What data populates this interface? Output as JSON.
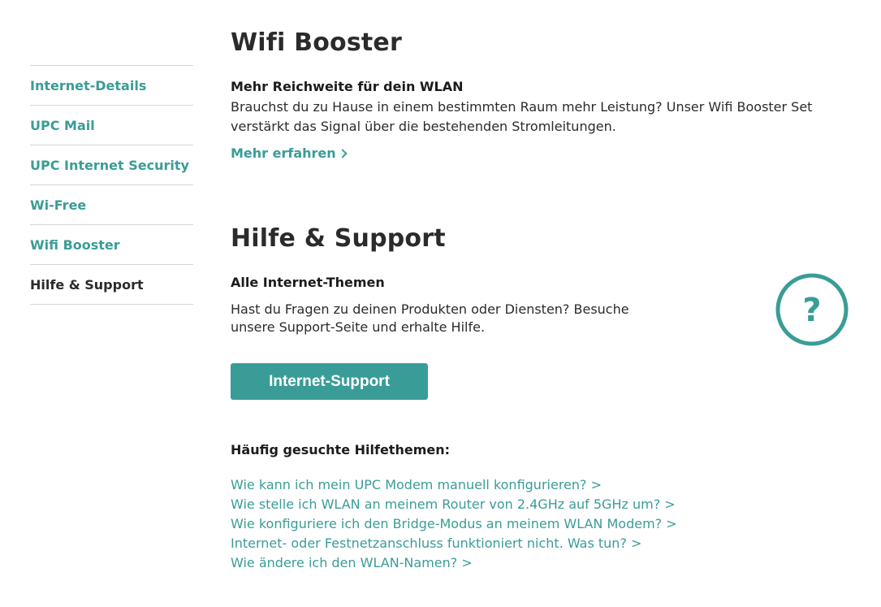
{
  "sidebar": {
    "items": [
      {
        "label": "Internet-Details",
        "active": false
      },
      {
        "label": "UPC Mail",
        "active": false
      },
      {
        "label": "UPC Internet Security",
        "active": false
      },
      {
        "label": "Wi-Free",
        "active": false
      },
      {
        "label": "Wifi Booster",
        "active": false
      },
      {
        "label": "Hilfe & Support",
        "active": true
      }
    ]
  },
  "booster": {
    "title": "Wifi Booster",
    "subtitle": "Mehr Reichweite für dein WLAN",
    "text": "Brauchst du zu Hause in einem bestimmten Raum mehr Leistung? Unser Wifi Booster Set verstärkt das Signal über die bestehenden Stromleitungen.",
    "link_label": "Mehr erfahren"
  },
  "support": {
    "title": "Hilfe & Support",
    "subtitle": "Alle Internet-Themen",
    "text": "Hast du Fragen zu deinen Produkten oder Diensten? Besuche unsere Support-Seite und erhalte Hilfe.",
    "button_label": "Internet-Support",
    "icon": "question-circle-icon",
    "faq_title": "Häufig gesuchte Hilfethemen:",
    "faq_links": [
      "Wie kann ich mein UPC Modem manuell konfigurieren? >",
      "Wie stelle ich WLAN an meinem Router von 2.4GHz auf 5GHz um? >",
      "Wie konfiguriere ich den Bridge-Modus an meinem WLAN Modem? >",
      "Internet- oder Festnetzanschluss funktioniert nicht. Was tun? >",
      "Wie ändere ich den WLAN-Namen? >"
    ]
  },
  "colors": {
    "accent": "#3a9c97",
    "text": "#2b2b2b",
    "divider": "#d6d6d6"
  }
}
